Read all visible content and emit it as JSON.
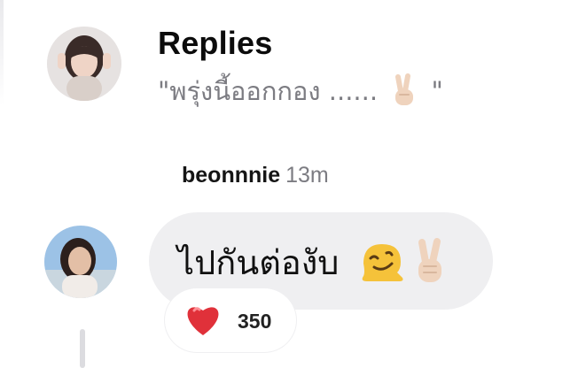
{
  "header": {
    "title": "Replies",
    "quote_open": "\"พรุ่งนี้ออกกอง ......",
    "quote_close": "\""
  },
  "comment": {
    "author": "beonnnie",
    "time": "13m",
    "text": "ไปกันต่องับ"
  },
  "reaction": {
    "icon": "heart-icon",
    "count": "350"
  },
  "colors": {
    "bubble": "#efeff1",
    "secondary_text": "#7c7c82",
    "heart": "#e0313a"
  }
}
